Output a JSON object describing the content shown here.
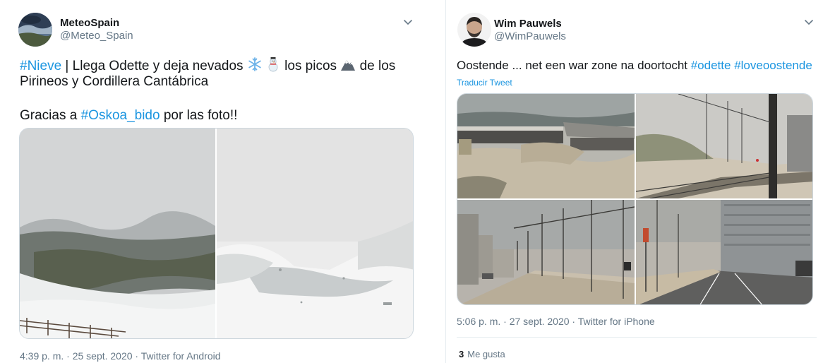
{
  "tweet_left": {
    "display_name": "MeteoSpain",
    "handle": "@Meteo_Spain",
    "line1_tag": "#Nieve",
    "line1_text": " | Llega Odette y deja nevados ",
    "line1_text2": " los picos ",
    "line1_text3": " de los",
    "line2": "Pirineos y Cordillera Cantábrica",
    "line3_prefix": "Gracias a ",
    "line3_tag": "#Oskoa_bido",
    "line3_suffix": " por las foto!!",
    "timestamp": "4:39 p. m. · 25 sept. 2020 · Twitter for Android",
    "icons": [
      "snowflake-icon",
      "snowman-icon",
      "mountain-icon",
      "chevron-down-icon"
    ]
  },
  "tweet_right": {
    "display_name": "Wim Pauwels",
    "handle": "@WimPauwels",
    "text_prefix": "Oostende ... net een war zone na doortocht ",
    "tag1": "#odette",
    "tag2": "#loveoostende",
    "translate": "Traducir Tweet",
    "timestamp": "5:06 p. m. · 27 sept. 2020 · Twitter for iPhone",
    "likes_count": "3",
    "likes_label": "Me gusta",
    "icons": [
      "chevron-down-icon"
    ]
  },
  "colors": {
    "link": "#1b95e0",
    "text": "#14171a",
    "secondary": "#657786",
    "border": "#e6ecf0"
  }
}
